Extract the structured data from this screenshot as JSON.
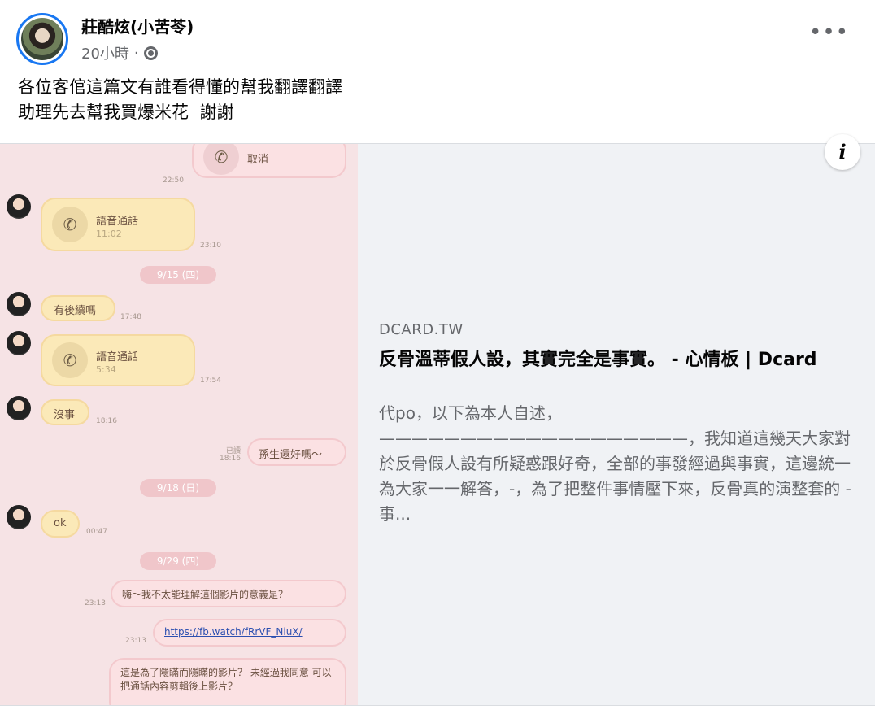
{
  "post": {
    "author": "莊酷炫(小苦苓)",
    "timestamp": "20小時",
    "separator": "·",
    "text_lines": [
      "各位客倌這篇文有誰看得懂的幫我翻譯翻譯",
      "助理先去幫我買爆米花  謝謝"
    ]
  },
  "icons": {
    "more": "more-options-icon",
    "globe": "globe-icon",
    "info": "info-icon",
    "phone": "phone-icon"
  },
  "link_preview": {
    "domain": "DCARD.TW",
    "title": "反骨溫蒂假人設，其實完全是事實。 - 心情板 | Dcard",
    "description": "代po，以下為本人自述，———————————————————，我知道這幾天大家對於反骨假人設有所疑惑跟好奇，全部的事發經過與事實，這邊統一為大家一一解答，-，為了把整件事情壓下來，反骨真的演整套的 - 事...",
    "info_label": "i"
  },
  "chat": {
    "cancel_label": "取消",
    "cancel_time": "22:50",
    "call1_label": "語音通話",
    "call1_duration": "11:02",
    "call1_time": "23:10",
    "date1": "9/15 (四)",
    "msg1": "有後續嗎",
    "msg1_time": "17:48",
    "call2_label": "語音通話",
    "call2_duration": "5:34",
    "call2_time": "17:54",
    "msg2": "沒事",
    "msg2_time": "18:16",
    "read_label": "已讀",
    "msg3": "孫生還好嗎～",
    "msg3_time": "18:16",
    "date2": "9/18 (日)",
    "msg4": "ok",
    "msg4_time": "00:47",
    "date3": "9/29 (四)",
    "msg5": "嗨～我不太能理解這個影片的意義是？",
    "msg5_time": "23:13",
    "link": "https://fb.watch/fRrVF_NiuX/",
    "link_time": "23:13",
    "msg6": "這是為了隱瞞而隱瞞的影片？ 未經過我同意 可以把通話內容剪輯後上影片？"
  },
  "colors": {
    "accent": "#1877f2",
    "preview_bg": "#f0f2f5",
    "muted": "#65676b",
    "chat_bg": "#f6e3e5"
  }
}
